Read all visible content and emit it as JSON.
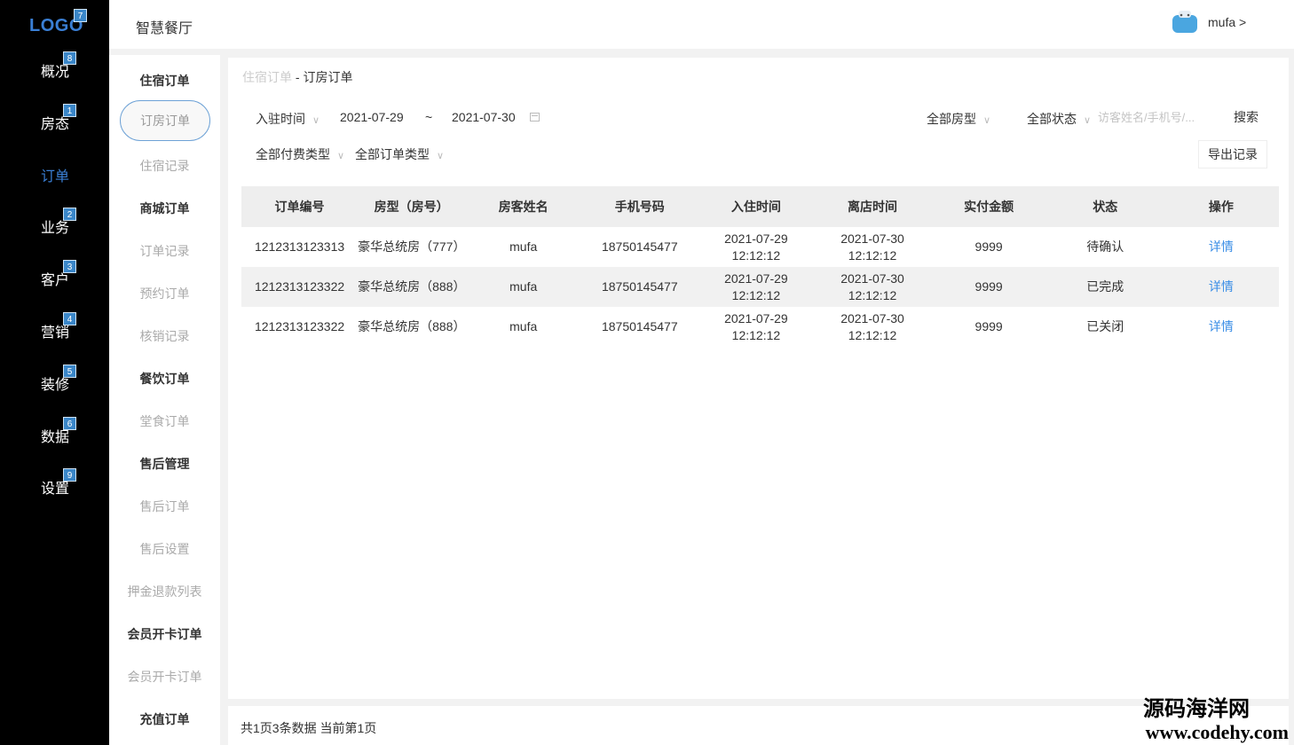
{
  "nav": {
    "logo": "LOGO",
    "logo_badge": "7",
    "items": [
      {
        "label": "概况",
        "badge": "8"
      },
      {
        "label": "房态",
        "badge": "1"
      },
      {
        "label": "订单",
        "badge": ""
      },
      {
        "label": "业务",
        "badge": "2"
      },
      {
        "label": "客户",
        "badge": "3"
      },
      {
        "label": "营销",
        "badge": "4"
      },
      {
        "label": "装修",
        "badge": "5"
      },
      {
        "label": "数据",
        "badge": "6"
      },
      {
        "label": "设置",
        "badge": "9"
      }
    ],
    "active_color": "#3a7fd5"
  },
  "header": {
    "app_title": "智慧餐厅",
    "user_name": "mufa >"
  },
  "submenu": {
    "items": [
      "住宿订单",
      "订房订单",
      "住宿记录",
      "商城订单",
      "订单记录",
      "预约订单",
      "核销记录",
      "餐饮订单",
      "堂食订单",
      "售后管理",
      "售后订单",
      "售后设置",
      "押金退款列表",
      "会员开卡订单",
      "会员开卡订单",
      "充值订单"
    ]
  },
  "breadcrumb": {
    "parent": "住宿订单",
    "separator": " - ",
    "current": "订房订单"
  },
  "filters": {
    "time_type": "入驻时间",
    "date_start": "2021-07-29",
    "date_sep": "~",
    "date_end": "2021-07-30",
    "room_type": "全部房型",
    "status": "全部状态",
    "search_placeholder": "访客姓名/手机号/...",
    "search_button": "搜索",
    "pay_type": "全部付费类型",
    "order_type": "全部订单类型",
    "export_button": "导出记录",
    "chevron": "∨"
  },
  "table": {
    "headers": [
      "订单编号",
      "房型（房号）",
      "房客姓名",
      "手机号码",
      "入住时间",
      "离店时间",
      "实付金额",
      "状态",
      "操作"
    ],
    "rows": [
      {
        "id": "1212313123313",
        "room": "豪华总统房（777）",
        "guest": "mufa",
        "phone": "18750145477",
        "checkin_date": "2021-07-29",
        "checkin_time": "12:12:12",
        "checkout_date": "2021-07-30",
        "checkout_time": "12:12:12",
        "amount": "9999",
        "status": "待确认",
        "action": "详情"
      },
      {
        "id": "1212313123322",
        "room": "豪华总统房（888）",
        "guest": "mufa",
        "phone": "18750145477",
        "checkin_date": "2021-07-29",
        "checkin_time": "12:12:12",
        "checkout_date": "2021-07-30",
        "checkout_time": "12:12:12",
        "amount": "9999",
        "status": "已完成",
        "action": "详情"
      },
      {
        "id": "1212313123322",
        "room": "豪华总统房（888）",
        "guest": "mufa",
        "phone": "18750145477",
        "checkin_date": "2021-07-29",
        "checkin_time": "12:12:12",
        "checkout_date": "2021-07-30",
        "checkout_time": "12:12:12",
        "amount": "9999",
        "status": "已关闭",
        "action": "详情"
      }
    ]
  },
  "footer": {
    "summary": "共1页3条数据 当前第1页"
  },
  "watermark": {
    "line1": "源码海洋网",
    "line2": "www.codehy.com"
  }
}
